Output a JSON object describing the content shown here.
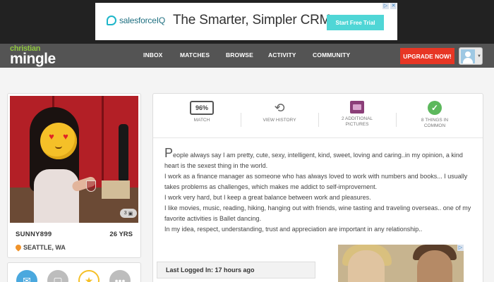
{
  "ad_banner": {
    "brand": "salesforceIQ",
    "headline": "The Smarter, Simpler CRM",
    "cta": "Start Free Trial",
    "choice_icons": [
      "adchoices-icon",
      "close-icon"
    ]
  },
  "nav": {
    "logo_top": "christian",
    "logo_bottom": "mingle",
    "items": [
      "INBOX",
      "MATCHES",
      "BROWSE",
      "ACTIVITY",
      "COMMUNITY"
    ],
    "upgrade_label": "UPGRADE NOW!",
    "colors": {
      "bar": "#545454",
      "upgrade": "#e73624",
      "logo_accent": "#8ec540"
    }
  },
  "profile": {
    "username": "SUNNY899",
    "age": "26 YRS",
    "location": "SEATTLE, WA",
    "photo_count": "3",
    "actions": [
      "email-icon",
      "chat-icon",
      "star-icon",
      "more-icon"
    ]
  },
  "stats": [
    {
      "icon": "percent-box-icon",
      "value": "96%",
      "label": "MATCH"
    },
    {
      "icon": "history-icon",
      "label": "VIEW HISTORY"
    },
    {
      "icon": "pictures-icon",
      "label": "2 ADDITIONAL PICTURES"
    },
    {
      "icon": "check-circle-icon",
      "label": "8 THINGS IN COMMON"
    }
  ],
  "bio": {
    "dropcap": "P",
    "paragraphs": [
      "eople always say I am pretty, cute, sexy, intelligent, kind, sweet, loving and caring..in my opinion, a kind heart is the sexest thing in the world.",
      "I work as a finance manager as someone who has always loved to work with numbers and books... I usually takes problems as challenges, which makes me addict to self-improvement.",
      "I work very hard, but I keep a great balance between work and pleasures.",
      "I like movies, music, reading, hiking, hanging out with friends, wine tasting and traveling overseas.. one of my favorite activities is Ballet dancing.",
      "In my idea, respect, understanding, trust and appreciation are important in any relationship.."
    ]
  },
  "last_logged_in": "Last Logged In: 17 hours ago"
}
